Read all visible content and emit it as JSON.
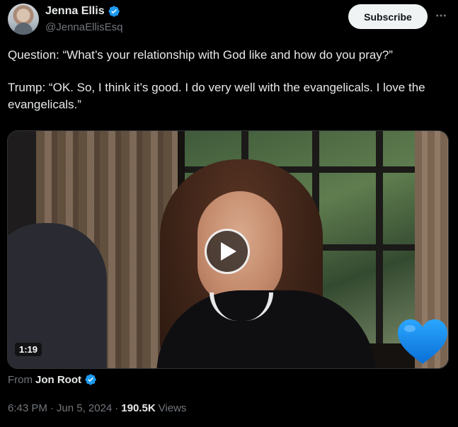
{
  "author": {
    "display_name": "Jenna Ellis",
    "handle": "@JennaEllisEsq",
    "verified": true
  },
  "header": {
    "subscribe_label": "Subscribe",
    "more_icon": "more-horizontal-icon"
  },
  "tweet": {
    "paragraphs": [
      "Question: “What’s your relationship with God like and how do you pray?”",
      "Trump: “OK. So, I think it’s good. I do very well with the evangelicals. I love the evangelicals.”"
    ]
  },
  "media": {
    "duration": "1:19",
    "play_icon": "play-icon",
    "overlay_emoji": "blue-heart-icon"
  },
  "source": {
    "from_label": "From",
    "name": "Jon Root",
    "verified": true
  },
  "meta": {
    "time": "6:43 PM",
    "separator_1": "·",
    "date": "Jun 5, 2024",
    "separator_2": "·",
    "views_count": "190.5K",
    "views_label": "Views"
  },
  "colors": {
    "background": "#000000",
    "text_primary": "#e7e9ea",
    "text_secondary": "#71767b",
    "verified_blue": "#1d9bf0",
    "subscribe_bg": "#eff3f4"
  }
}
